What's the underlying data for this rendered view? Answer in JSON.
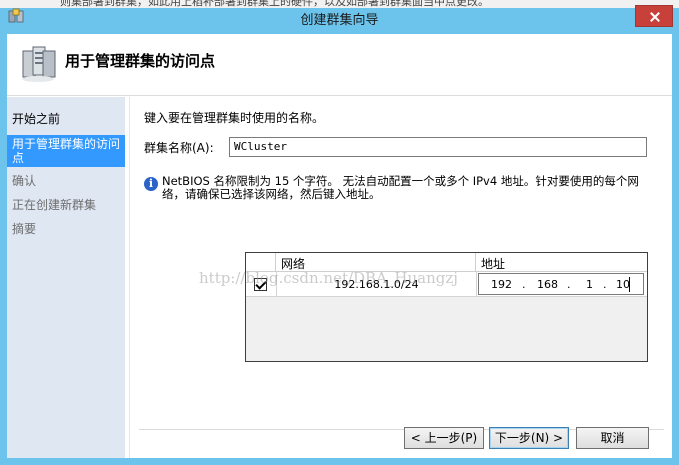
{
  "window": {
    "title": "创建群集向导",
    "background_text": "则集部署到群集，如此用上稻补部署到群集上的硬件，以及如部署到群集面当中点更改。"
  },
  "header": {
    "title": "用于管理群集的访问点"
  },
  "nav": {
    "items": [
      {
        "label": "开始之前",
        "state": "normal"
      },
      {
        "label": "用于管理群集的访问点",
        "state": "active"
      },
      {
        "label": "确认",
        "state": "disabled"
      },
      {
        "label": "正在创建新群集",
        "state": "disabled"
      },
      {
        "label": "摘要",
        "state": "disabled"
      }
    ]
  },
  "content": {
    "instruction": "键入要在管理群集时使用的名称。",
    "cluster_name_label": "群集名称(A):",
    "cluster_name_value": "WCluster",
    "info_text": "NetBIOS 名称限制为 15 个字符。 无法自动配置一个或多个 IPv4 地址。针对要使用的每个网络，请确保已选择该网络，然后键入地址。",
    "grid": {
      "col_network": "网络",
      "col_address": "地址",
      "rows": [
        {
          "checked": true,
          "network": "192.168.1.0/24",
          "ip": [
            "192",
            "168",
            "1",
            "10"
          ]
        }
      ]
    },
    "watermark": "http://blog.csdn.net/DBA_Huangzj"
  },
  "buttons": {
    "prev": "< 上一步(P)",
    "next": "下一步(N) >",
    "cancel": "取消"
  },
  "colors": {
    "titlebar": "#6cc4ec",
    "nav_bg": "#dfe7f3",
    "nav_active": "#3399ff",
    "close": "#c8403a"
  }
}
